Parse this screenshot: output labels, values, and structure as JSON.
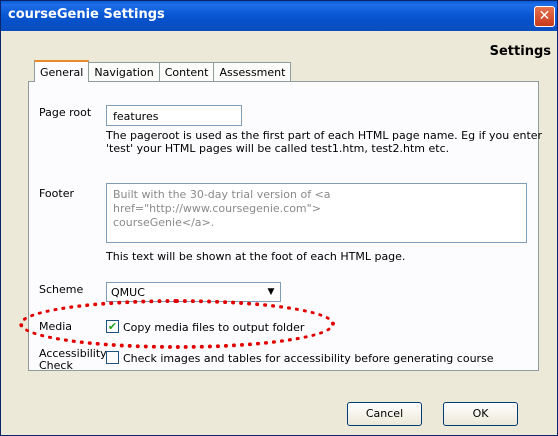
{
  "window": {
    "title": "courseGenie Settings",
    "close_glyph": "✕",
    "heading": "Settings"
  },
  "tabs": [
    {
      "label": "General",
      "active": true
    },
    {
      "label": "Navigation",
      "active": false
    },
    {
      "label": "Content",
      "active": false
    },
    {
      "label": "Assessment",
      "active": false
    }
  ],
  "general": {
    "page_root": {
      "label": "Page root",
      "value": "features",
      "help_line1": "The pageroot is used as the first part of each HTML page name. Eg if you enter",
      "help_line2": "'test' your HTML pages will be called test1.htm, test2.htm etc."
    },
    "footer": {
      "label": "Footer",
      "value_line1": "Built with the 30-day trial version of <a href=\"http://www.coursegenie.com\">",
      "value_line2": "courseGenie</a>.",
      "help": "This text will be shown at the foot of each HTML page."
    },
    "scheme": {
      "label": "Scheme",
      "selected": "QMUC",
      "arrow_glyph": "▼"
    },
    "media": {
      "label": "Media",
      "checkbox_label": "Copy media files to output folder",
      "checked": true,
      "check_glyph": "✔"
    },
    "accessibility": {
      "label_line1": "Accessibility",
      "label_line2": "Check",
      "checkbox_label": "Check images and tables for accessibility before generating course",
      "checked": false
    }
  },
  "buttons": {
    "cancel": "Cancel",
    "ok": "OK"
  },
  "colors": {
    "titlebar": "#0a58d4",
    "highlight": "#e00000"
  }
}
